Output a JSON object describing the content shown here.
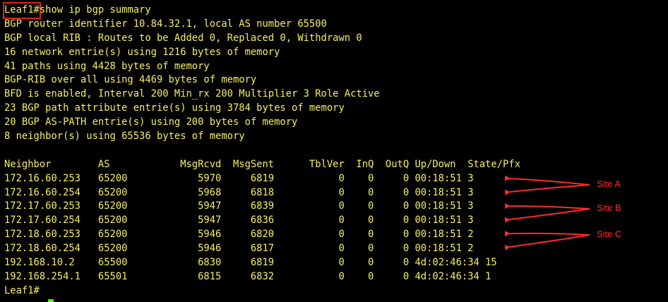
{
  "terminal": {
    "prompt": "Leaf1#",
    "command": "show ip bgp summary",
    "header_lines": [
      "BGP router identifier 10.84.32.1, local AS number 65500",
      "BGP local RIB : Routes to be Added 0, Replaced 0, Withdrawn 0",
      "16 network entrie(s) using 1216 bytes of memory",
      "41 paths using 4428 bytes of memory",
      "BGP-RIB over all using 4469 bytes of memory",
      "BFD is enabled, Interval 200 Min_rx 200 Multiplier 3 Role Active",
      "23 BGP path attribute entrie(s) using 3784 bytes of memory",
      "20 BGP AS-PATH entrie(s) using 200 bytes of memory",
      "8 neighbor(s) using 65536 bytes of memory"
    ],
    "table_header": "Neighbor        AS            MsgRcvd  MsgSent      TblVer  InQ  OutQ Up/Down  State/Pfx",
    "table_rows": [
      "172.16.60.253   65200            5970     6819           0    0     0 00:18:51 3",
      "172.16.60.254   65200            5968     6818           0    0     0 00:18:51 3",
      "172.17.60.253   65200            5947     6839           0    0     0 00:18:51 3",
      "172.17.60.254   65200            5947     6836           0    0     0 00:18:51 3",
      "172.18.60.253   65200            5946     6820           0    0     0 00:18:51 2",
      "172.18.60.254   65200            5946     6817           0    0     0 00:18:51 2",
      "192.168.10.2    65500            6830     6819           0    0     0 4d:02:46:34 15",
      "192.168.254.1   65501            6815     6832           0    0     0 4d:02:46:34 1"
    ],
    "end_prompt": "Leaf1#"
  },
  "annotations": {
    "site_a": "Site A",
    "site_b": "Site B",
    "site_c": "Site C"
  },
  "colors": {
    "background": "#000000",
    "text": "#f5ee61",
    "annotation": "#ff2a2a",
    "cursor": "#39ff14"
  }
}
